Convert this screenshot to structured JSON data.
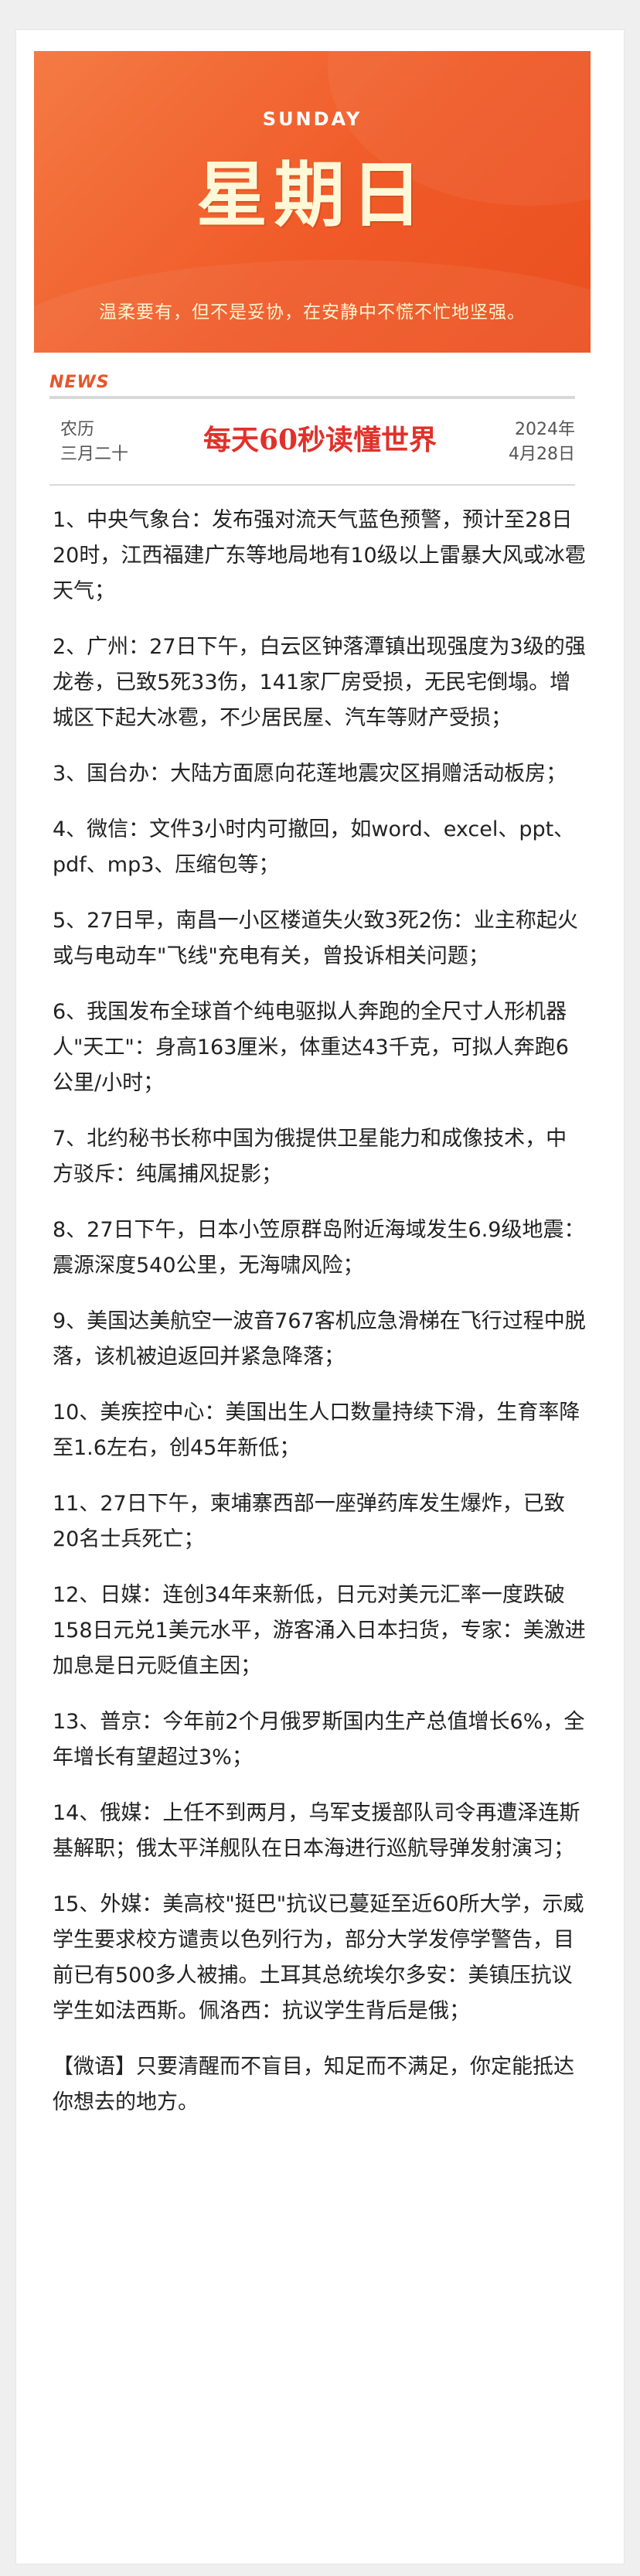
{
  "banner": {
    "day_en": "SUNDAY",
    "day_zh": "星期日",
    "motto": "温柔要有，但不是妥协，在安静中不慌不忙地坚强。"
  },
  "header": {
    "news_label": "NEWS",
    "lunar_line1": "农历",
    "lunar_line2": "三月二十",
    "headline": "每天60秒读懂世界",
    "date_line1": "2024年",
    "date_line2": "4月28日"
  },
  "items": [
    "1、中央气象台：发布强对流天气蓝色预警，预计至28日20时，江西福建广东等地局地有10级以上雷暴大风或冰雹天气；",
    "2、广州：27日下午，白云区钟落潭镇出现强度为3级的强龙卷，已致5死33伤，141家厂房受损，无民宅倒塌。增城区下起大冰雹，不少居民屋、汽车等财产受损；",
    "3、国台办：大陆方面愿向花莲地震灾区捐赠活动板房；",
    "4、微信：文件3小时内可撤回，如word、excel、ppt、pdf、mp3、压缩包等；",
    "5、27日早，南昌一小区楼道失火致3死2伤：业主称起火或与电动车\"飞线\"充电有关，曾投诉相关问题；",
    "6、我国发布全球首个纯电驱拟人奔跑的全尺寸人形机器人\"天工\"：身高163厘米，体重达43千克，可拟人奔跑6公里/小时；",
    "7、北约秘书长称中国为俄提供卫星能力和成像技术，中方驳斥：纯属捕风捉影；",
    "8、27日下午，日本小笠原群岛附近海域发生6.9级地震：震源深度540公里，无海啸风险；",
    "9、美国达美航空一波音767客机应急滑梯在飞行过程中脱落，该机被迫返回并紧急降落；",
    "10、美疾控中心：美国出生人口数量持续下滑，生育率降至1.6左右，创45年新低；",
    "11、27日下午，柬埔寨西部一座弹药库发生爆炸，已致20名士兵死亡；",
    "12、日媒：连创34年来新低，日元对美元汇率一度跌破158日元兑1美元水平，游客涌入日本扫货，专家：美激进加息是日元贬值主因；",
    "13、普京：今年前2个月俄罗斯国内生产总值增长6%，全年增长有望超过3%；",
    "14、俄媒：上任不到两月，乌军支援部队司令再遭泽连斯基解职；俄太平洋舰队在日本海进行巡航导弹发射演习；",
    "15、外媒：美高校\"挺巴\"抗议已蔓延至近60所大学，示威学生要求校方谴责以色列行为，部分大学发停学警告，目前已有500多人被捕。土耳其总统埃尔多安：美镇压抗议学生如法西斯。佩洛西：抗议学生背后是俄；"
  ],
  "quote": "【微语】只要清醒而不盲目，知足而不满足，你定能抵达你想去的地方。"
}
